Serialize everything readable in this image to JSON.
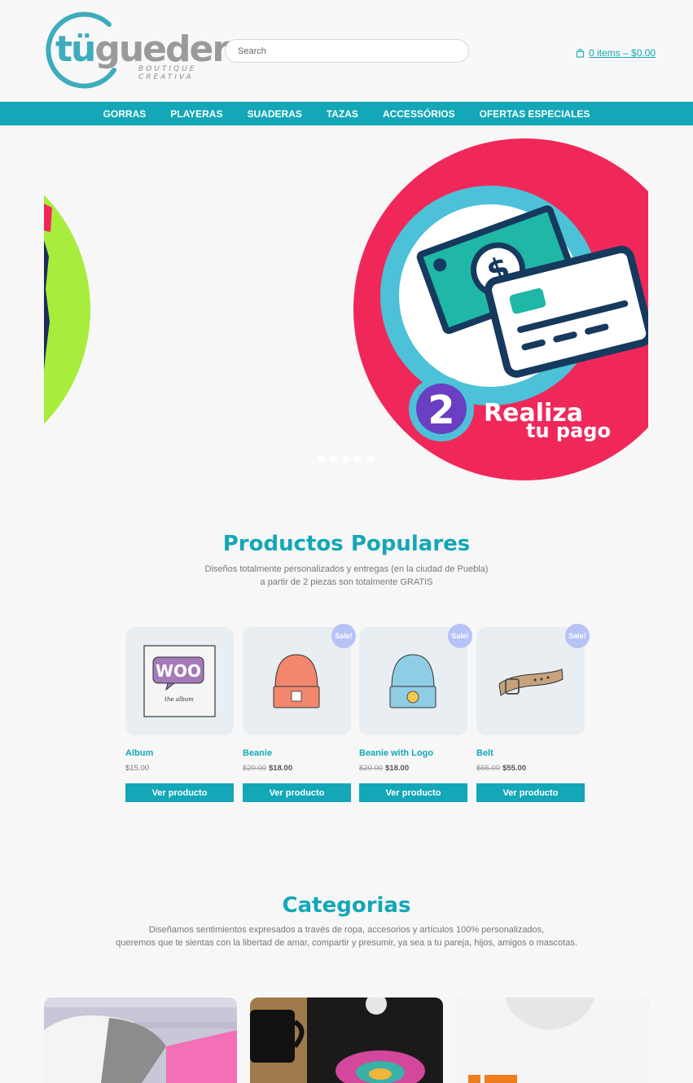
{
  "brand": {
    "logo_text_a": "tü",
    "logo_text_b": "gueder",
    "logo_tagline": "BOUTIQUE CREATIVA"
  },
  "search": {
    "placeholder": "Search"
  },
  "cart": {
    "label": "0 items – $0.00"
  },
  "nav": {
    "items": [
      "GORRAS",
      "PLAYERAS",
      "SUADERAS",
      "TAZAS",
      "ACCESSÓRIOS",
      "OFERTAS ESPECIALES"
    ]
  },
  "slider": {
    "number": "2",
    "line1": "Realiza",
    "line2": "tu pago",
    "dot_count": 5,
    "active_dot": 1
  },
  "popular": {
    "title": "Productos Populares",
    "subtitle_line1": "Diseños totalmente personalizados y entregas (en la ciudad de Puebla)",
    "subtitle_line2": "a partir de 2 piezas son totalmente GRATIS"
  },
  "products": [
    {
      "name": "Album",
      "price": "$15.00",
      "old_price": "",
      "sale": "",
      "button": "Ver producto",
      "icon": "album-icon",
      "cover_text": "WOO",
      "cover_caption": "the album"
    },
    {
      "name": "Beanie",
      "price": "$18.00",
      "old_price": "$20.00",
      "sale": "Sale!",
      "button": "Ver producto",
      "icon": "beanie-icon",
      "color": "#f2876e"
    },
    {
      "name": "Beanie with Logo",
      "price": "$18.00",
      "old_price": "$20.00",
      "sale": "Sale!",
      "button": "Ver producto",
      "icon": "beanie-logo-icon",
      "color": "#8fcde4"
    },
    {
      "name": "Belt",
      "price": "$55.00",
      "old_price": "$65.00",
      "sale": "Sale!",
      "button": "Ver producto",
      "icon": "belt-icon"
    }
  ],
  "categories": {
    "title": "Categorias",
    "subtitle_line1": "Diseñamos sentimientos expresados a través de ropa, accesorios y artículos 100% personalizados,",
    "subtitle_line2": "queremos que te sientas con la libertad de amar, compartir y presumir, ya sea a tu pareja, hijos, amigos o mascotas."
  },
  "colors": {
    "accent": "#13a7b7",
    "sale_badge": "#b7c2f6",
    "hero_pink": "#f0285a",
    "hero_green": "#a8ec3c"
  }
}
